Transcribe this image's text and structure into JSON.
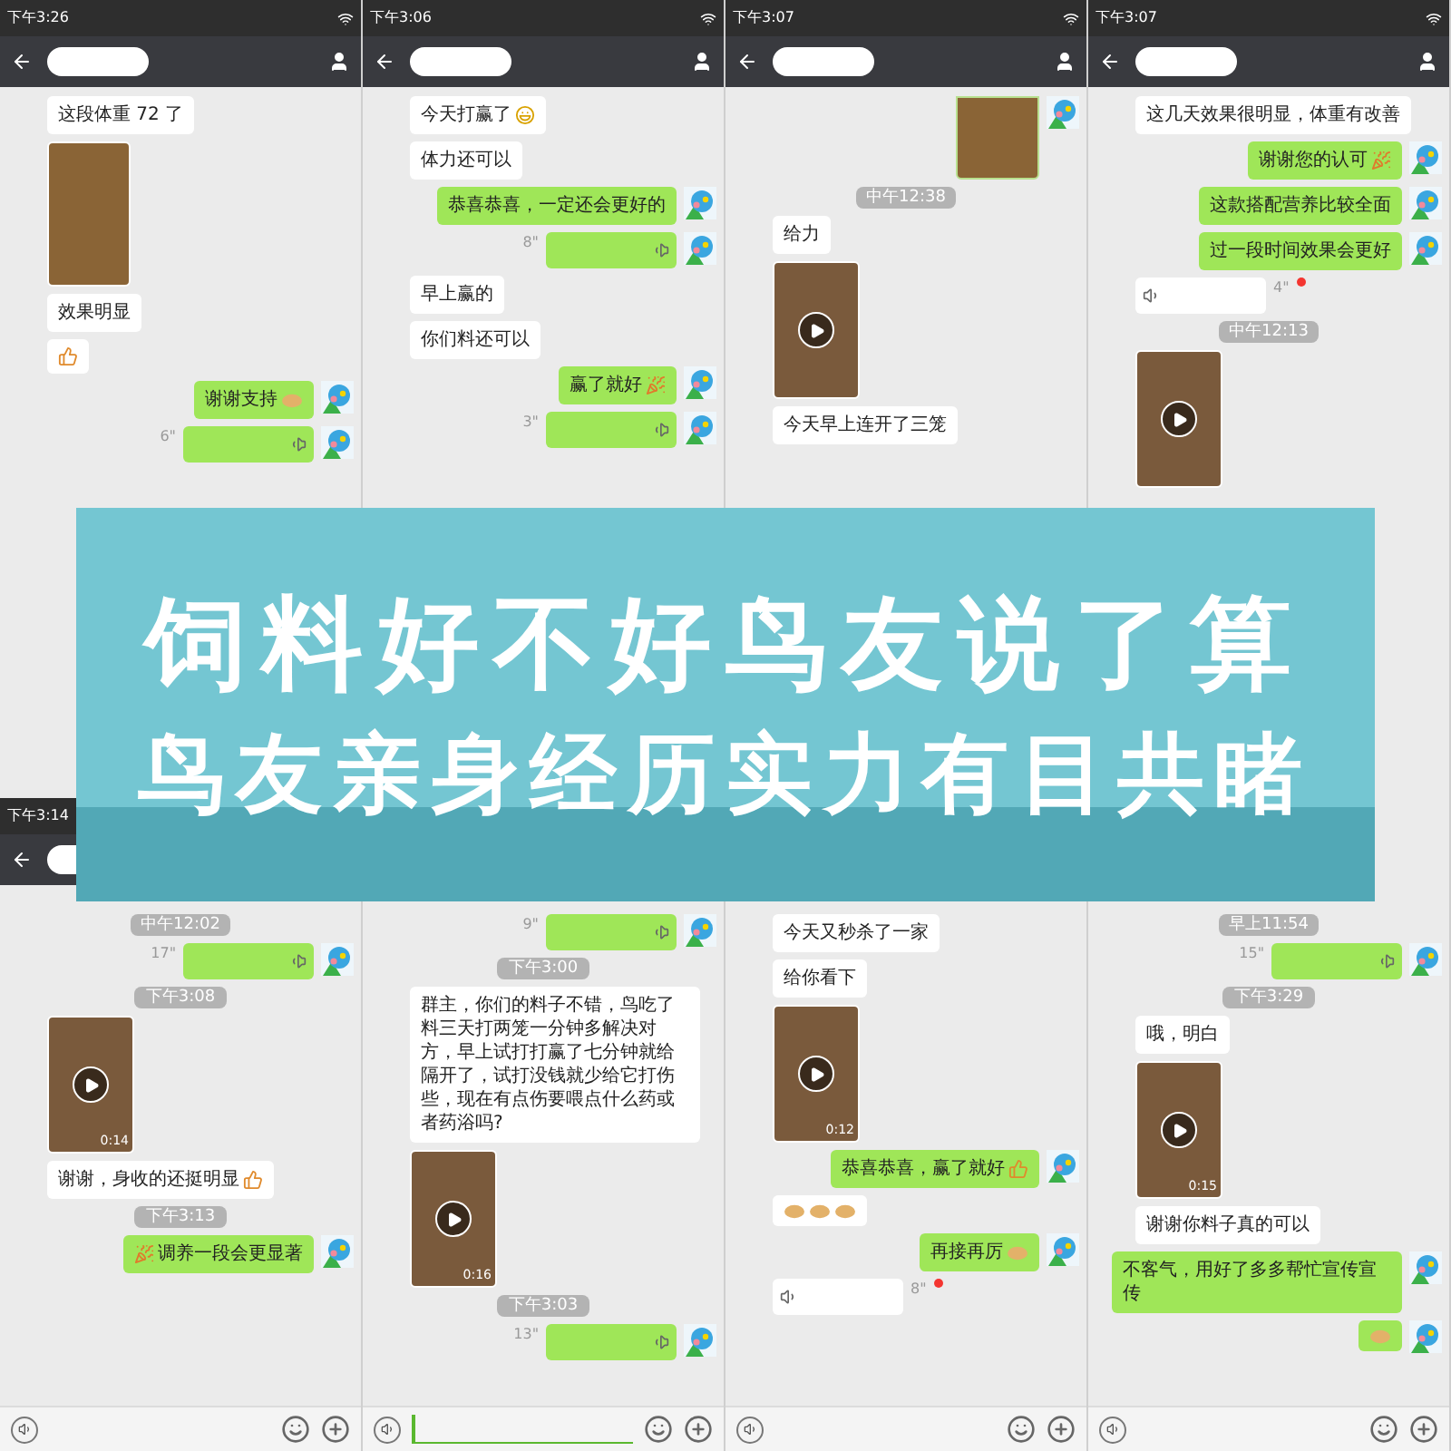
{
  "top_row": [
    {
      "header": {
        "status_time": "下午3:26"
      },
      "messages": [
        {
          "kind": "text",
          "outgoing": false,
          "text": "这段体重 72 了"
        },
        {
          "kind": "photo",
          "outgoing": false,
          "cut_off": false
        },
        {
          "kind": "text",
          "outgoing": false,
          "text": "效果明显"
        },
        {
          "kind": "text",
          "outgoing": false,
          "stickers": [
            {
              "kind": "thumb"
            }
          ]
        },
        {
          "kind": "text",
          "outgoing": true,
          "text": "谢谢支持",
          "stickers": [
            {
              "kind": "bun"
            }
          ],
          "sticker_first": false
        },
        {
          "kind": "voice",
          "outgoing": true,
          "duration": "6\""
        }
      ]
    },
    {
      "header": {
        "status_time": "下午3:06"
      },
      "messages": [
        {
          "kind": "text",
          "outgoing": false,
          "text": "今天打赢了",
          "stickers": [
            {
              "kind": "grin"
            }
          ],
          "sticker_first": false
        },
        {
          "kind": "text",
          "outgoing": false,
          "text": "体力还可以"
        },
        {
          "kind": "text",
          "outgoing": true,
          "text": "恭喜恭喜，一定还会更好的"
        },
        {
          "kind": "voice",
          "outgoing": true,
          "duration": "8\""
        },
        {
          "kind": "text",
          "outgoing": false,
          "text": "早上赢的"
        },
        {
          "kind": "text",
          "outgoing": false,
          "text": "你们料还可以"
        },
        {
          "kind": "text",
          "outgoing": true,
          "text": "赢了就好",
          "stickers": [
            {
              "kind": "popper"
            }
          ],
          "sticker_first": false
        },
        {
          "kind": "voice",
          "outgoing": true,
          "duration": "3\""
        }
      ]
    },
    {
      "header": {
        "status_time": "下午3:07"
      },
      "messages": [
        {
          "kind": "photo",
          "outgoing": true,
          "cut_off": true
        },
        {
          "kind": "time",
          "text": "中午12:38"
        },
        {
          "kind": "text",
          "outgoing": false,
          "text": "给力"
        },
        {
          "kind": "video",
          "outgoing": false
        },
        {
          "kind": "text",
          "outgoing": false,
          "text": "今天早上连开了三笼"
        }
      ]
    },
    {
      "header": {
        "status_time": "下午3:07"
      },
      "messages": [
        {
          "kind": "text",
          "outgoing": false,
          "text": "这几天效果很明显，体重有改善"
        },
        {
          "kind": "text",
          "outgoing": true,
          "text": "谢谢您的认可",
          "stickers": [
            {
              "kind": "popper"
            }
          ],
          "sticker_first": false
        },
        {
          "kind": "text",
          "outgoing": true,
          "text": "这款搭配营养比较全面"
        },
        {
          "kind": "text",
          "outgoing": true,
          "text": "过一段时间效果会更好"
        },
        {
          "kind": "voice",
          "outgoing": false,
          "duration": "4\"",
          "unread": true
        },
        {
          "kind": "time",
          "text": "中午12:13"
        },
        {
          "kind": "video",
          "outgoing": false
        }
      ]
    }
  ],
  "banner": {
    "line_1": "饲料好不好鸟友说了算",
    "line_2": "鸟友亲身经历实力有目共睹"
  },
  "bottom_row": [
    {
      "header": {
        "status_time": "下午3:14"
      },
      "input_bar": {
        "field_focused": false
      },
      "messages": [
        {
          "kind": "time",
          "text": "中午12:02"
        },
        {
          "kind": "voice",
          "outgoing": true,
          "duration": "17\""
        },
        {
          "kind": "time",
          "text": "下午3:08"
        },
        {
          "kind": "video",
          "outgoing": false,
          "duration": "0:14"
        },
        {
          "kind": "text",
          "outgoing": false,
          "text": "谢谢，身收的还挺明显",
          "stickers": [
            {
              "kind": "thumb"
            }
          ],
          "sticker_first": false
        },
        {
          "kind": "time",
          "text": "下午3:13"
        },
        {
          "kind": "text",
          "outgoing": true,
          "text": "调养一段会更显著",
          "stickers": [
            {
              "kind": "popper"
            }
          ],
          "sticker_first": true
        }
      ]
    },
    {
      "input_bar": {
        "field_focused": true
      },
      "messages": [
        {
          "kind": "voice",
          "outgoing": true,
          "duration": "9\""
        },
        {
          "kind": "time",
          "text": "下午3:00"
        },
        {
          "kind": "text",
          "outgoing": false,
          "text": "群主，你们的料子不错，鸟吃了料三天打两笼一分钟多解决对方，早上试打打赢了七分钟就给隔开了，试打没钱就少给它打伤些，现在有点伤要喂点什么药或者药浴吗?"
        },
        {
          "kind": "video",
          "outgoing": false,
          "duration": "0:16"
        },
        {
          "kind": "time",
          "text": "下午3:03"
        },
        {
          "kind": "voice",
          "outgoing": true,
          "duration": "13\""
        }
      ]
    },
    {
      "input_bar": {
        "field_focused": false
      },
      "messages": [
        {
          "kind": "text",
          "outgoing": false,
          "text": "今天又秒杀了一家"
        },
        {
          "kind": "text",
          "outgoing": false,
          "text": "给你看下"
        },
        {
          "kind": "video",
          "outgoing": false,
          "duration": "0:12"
        },
        {
          "kind": "text",
          "outgoing": true,
          "text": "恭喜恭喜，赢了就好",
          "stickers": [
            {
              "kind": "thumb"
            }
          ],
          "sticker_first": false
        },
        {
          "kind": "text",
          "outgoing": false,
          "stickers": [
            {
              "kind": "bun"
            },
            {
              "kind": "bun"
            },
            {
              "kind": "bun"
            }
          ]
        },
        {
          "kind": "text",
          "outgoing": true,
          "text": "再接再厉",
          "stickers": [
            {
              "kind": "bun"
            }
          ],
          "sticker_first": false
        },
        {
          "kind": "voice",
          "outgoing": false,
          "duration": "8\"",
          "unread": true
        }
      ]
    },
    {
      "input_bar": {
        "field_focused": false
      },
      "messages": [
        {
          "kind": "time",
          "text": "早上11:54"
        },
        {
          "kind": "voice",
          "outgoing": true,
          "duration": "15\""
        },
        {
          "kind": "time",
          "text": "下午3:29"
        },
        {
          "kind": "text",
          "outgoing": false,
          "text": "哦，明白"
        },
        {
          "kind": "video",
          "outgoing": false,
          "duration": "0:15"
        },
        {
          "kind": "text",
          "outgoing": false,
          "text": "谢谢你料子真的可以"
        },
        {
          "kind": "text",
          "outgoing": true,
          "text": "不客气，用好了多多帮忙宣传宣传"
        },
        {
          "kind": "text",
          "outgoing": true,
          "stickers": [
            {
              "kind": "bun"
            }
          ]
        }
      ]
    }
  ]
}
